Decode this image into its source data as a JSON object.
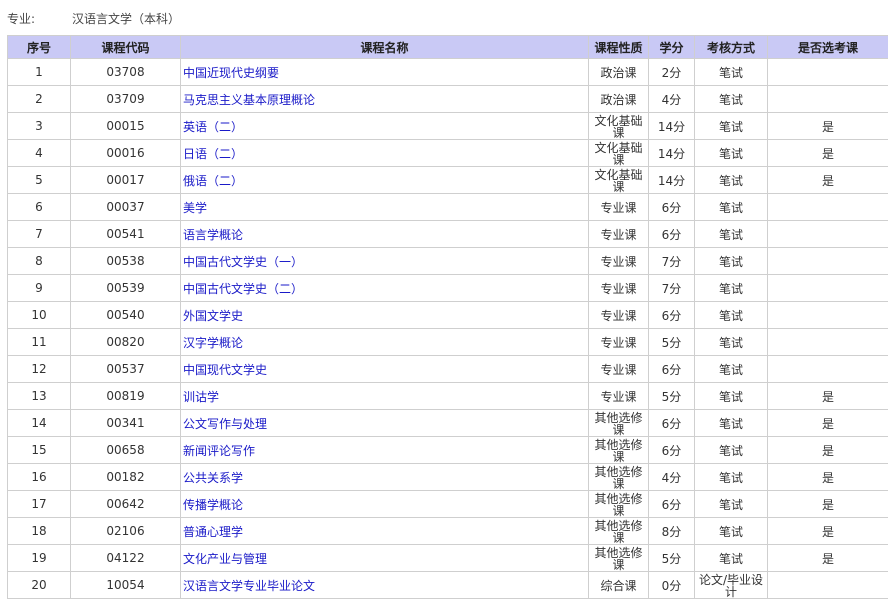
{
  "major": {
    "label": "专业:",
    "value": "汉语言文学（本科）"
  },
  "table": {
    "headers": [
      "序号",
      "课程代码",
      "课程名称",
      "课程性质",
      "学分",
      "考核方式",
      "是否选考课"
    ],
    "rows": [
      {
        "no": "1",
        "code": "03708",
        "name": "中国近现代史纲要",
        "nature": "政治课",
        "credit": "2分",
        "exam": "笔试",
        "elective": ""
      },
      {
        "no": "2",
        "code": "03709",
        "name": "马克思主义基本原理概论",
        "nature": "政治课",
        "credit": "4分",
        "exam": "笔试",
        "elective": ""
      },
      {
        "no": "3",
        "code": "00015",
        "name": "英语（二）",
        "nature": "文化基础课",
        "credit": "14分",
        "exam": "笔试",
        "elective": "是"
      },
      {
        "no": "4",
        "code": "00016",
        "name": "日语（二）",
        "nature": "文化基础课",
        "credit": "14分",
        "exam": "笔试",
        "elective": "是"
      },
      {
        "no": "5",
        "code": "00017",
        "name": "俄语（二）",
        "nature": "文化基础课",
        "credit": "14分",
        "exam": "笔试",
        "elective": "是"
      },
      {
        "no": "6",
        "code": "00037",
        "name": "美学",
        "nature": "专业课",
        "credit": "6分",
        "exam": "笔试",
        "elective": ""
      },
      {
        "no": "7",
        "code": "00541",
        "name": "语言学概论",
        "nature": "专业课",
        "credit": "6分",
        "exam": "笔试",
        "elective": ""
      },
      {
        "no": "8",
        "code": "00538",
        "name": "中国古代文学史（一）",
        "nature": "专业课",
        "credit": "7分",
        "exam": "笔试",
        "elective": ""
      },
      {
        "no": "9",
        "code": "00539",
        "name": "中国古代文学史（二）",
        "nature": "专业课",
        "credit": "7分",
        "exam": "笔试",
        "elective": ""
      },
      {
        "no": "10",
        "code": "00540",
        "name": "外国文学史",
        "nature": "专业课",
        "credit": "6分",
        "exam": "笔试",
        "elective": ""
      },
      {
        "no": "11",
        "code": "00820",
        "name": "汉字学概论",
        "nature": "专业课",
        "credit": "5分",
        "exam": "笔试",
        "elective": ""
      },
      {
        "no": "12",
        "code": "00537",
        "name": "中国现代文学史",
        "nature": "专业课",
        "credit": "6分",
        "exam": "笔试",
        "elective": ""
      },
      {
        "no": "13",
        "code": "00819",
        "name": "训诂学",
        "nature": "专业课",
        "credit": "5分",
        "exam": "笔试",
        "elective": "是"
      },
      {
        "no": "14",
        "code": "00341",
        "name": "公文写作与处理",
        "nature": "其他选修课",
        "credit": "6分",
        "exam": "笔试",
        "elective": "是"
      },
      {
        "no": "15",
        "code": "00658",
        "name": "新闻评论写作",
        "nature": "其他选修课",
        "credit": "6分",
        "exam": "笔试",
        "elective": "是"
      },
      {
        "no": "16",
        "code": "00182",
        "name": "公共关系学",
        "nature": "其他选修课",
        "credit": "4分",
        "exam": "笔试",
        "elective": "是"
      },
      {
        "no": "17",
        "code": "00642",
        "name": "传播学概论",
        "nature": "其他选修课",
        "credit": "6分",
        "exam": "笔试",
        "elective": "是"
      },
      {
        "no": "18",
        "code": "02106",
        "name": "普通心理学",
        "nature": "其他选修课",
        "credit": "8分",
        "exam": "笔试",
        "elective": "是"
      },
      {
        "no": "19",
        "code": "04122",
        "name": "文化产业与管理",
        "nature": "其他选修课",
        "credit": "5分",
        "exam": "笔试",
        "elective": "是"
      },
      {
        "no": "20",
        "code": "10054",
        "name": "汉语言文学专业毕业论文",
        "nature": "综合课",
        "credit": "0分",
        "exam": "论文/毕业设计",
        "elective": ""
      }
    ]
  }
}
